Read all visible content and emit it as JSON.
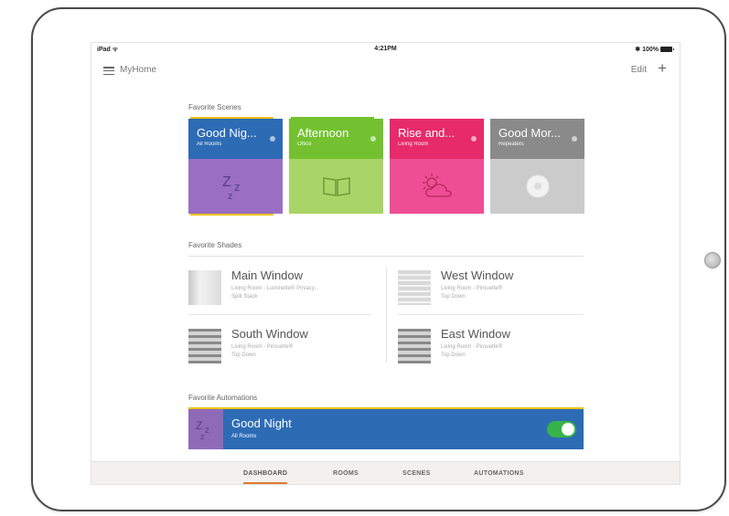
{
  "status_bar": {
    "carrier": "iPad ᯤ",
    "time": "4:21PM",
    "battery": "✱ 100%"
  },
  "nav": {
    "title": "MyHome",
    "edit_label": "Edit",
    "add_icon": "plus-icon",
    "menu_icon": "hamburger-menu-icon"
  },
  "scenes": {
    "section_title": "Favorite Scenes",
    "items": [
      {
        "name": "Good Nig...",
        "room": "All Rooms",
        "icon": "zzz-sleep-icon",
        "top_color": "#2d6bb5",
        "bottom_color": "#9a6fc1",
        "accent_color": "#f0c200"
      },
      {
        "name": "Afternoon",
        "room": "Office",
        "icon": "book-icon",
        "top_color": "#73c130",
        "bottom_color": "#a9d468",
        "accent_color": "#73c130"
      },
      {
        "name": "Rise and...",
        "room": "Living Room",
        "icon": "sun-cloud-icon",
        "top_color": "#e62a6a",
        "bottom_color": "#ee4e93",
        "accent_color": "#e62a6a"
      },
      {
        "name": "Good Mor...",
        "room": "Repeaters",
        "icon": "repeater-device-icon",
        "top_color": "#8a8a8a",
        "bottom_color": "#cbcbcb",
        "accent_color": "#8a8a8a"
      }
    ]
  },
  "shades": {
    "section_title": "Favorite Shades",
    "items": [
      {
        "name": "Main Window",
        "desc_line1": "Living Room - Luminette® Privacy...",
        "desc_line2": "Split Stack"
      },
      {
        "name": "West Window",
        "desc_line1": "Living Room - Pirouette®",
        "desc_line2": "Top Down"
      },
      {
        "name": "South Window",
        "desc_line1": "Living Room - Pirouette®",
        "desc_line2": "Top Down"
      },
      {
        "name": "East Window",
        "desc_line1": "Living Room - Pirouette®",
        "desc_line2": "Top Down"
      }
    ]
  },
  "automations": {
    "section_title": "Favorite Automations",
    "item": {
      "name": "Good Night",
      "room": "All Rooms",
      "enabled": true,
      "icon": "zzz-sleep-icon"
    }
  },
  "tabs": [
    {
      "label": "DASHBOARD",
      "active": true
    },
    {
      "label": "ROOMS",
      "active": false
    },
    {
      "label": "SCENES",
      "active": false
    },
    {
      "label": "AUTOMATIONS",
      "active": false
    }
  ],
  "colors": {
    "accent_tab": "#e07b2e",
    "toggle_on": "#36b34a",
    "automation_bg": "#2d6bb5"
  }
}
